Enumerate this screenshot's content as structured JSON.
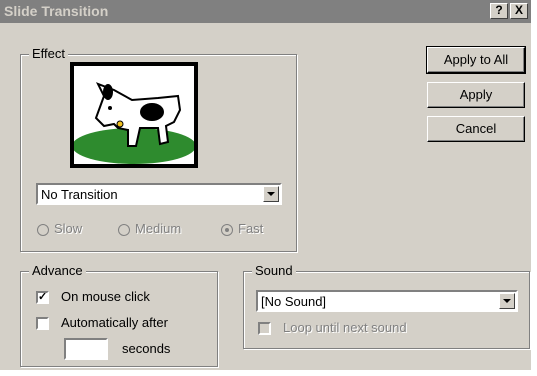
{
  "window": {
    "title": "Slide Transition",
    "help_glyph": "?",
    "close_glyph": "X"
  },
  "effect": {
    "group_label": "Effect",
    "image_name": "dog-picture",
    "transition_value": "No Transition",
    "speeds": [
      {
        "label": "Slow",
        "selected": false
      },
      {
        "label": "Medium",
        "selected": false
      },
      {
        "label": "Fast",
        "selected": true
      }
    ]
  },
  "buttons": {
    "apply_all": "Apply to All",
    "apply": "Apply",
    "cancel": "Cancel"
  },
  "advance": {
    "group_label": "Advance",
    "on_mouse_click": "On mouse click",
    "on_mouse_click_checked": true,
    "auto_after": "Automatically after",
    "auto_after_checked": false,
    "seconds_label": "seconds",
    "seconds_value": ""
  },
  "sound": {
    "group_label": "Sound",
    "value": "[No Sound]",
    "loop_label": "Loop until next sound"
  }
}
